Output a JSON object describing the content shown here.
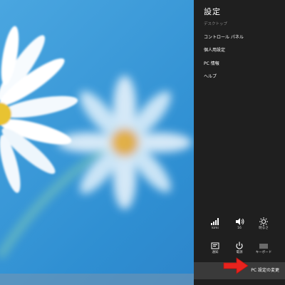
{
  "charm": {
    "title": "設定",
    "context": "デスクトップ",
    "items": [
      {
        "label": "コントロール パネル"
      },
      {
        "label": "個人用設定"
      },
      {
        "label": "PC 情報"
      },
      {
        "label": "ヘルプ"
      }
    ],
    "quick_settings": [
      {
        "icon": "network-icon",
        "label": "kimi"
      },
      {
        "icon": "volume-icon",
        "label": "16"
      },
      {
        "icon": "brightness-icon",
        "label": "明るさ"
      },
      {
        "icon": "notification-icon",
        "label": "通知"
      },
      {
        "icon": "power-icon",
        "label": "電源"
      },
      {
        "icon": "keyboard-icon",
        "label": "キーボード"
      }
    ],
    "change_pc_settings": "PC 設定の変更"
  },
  "colors": {
    "charm_background": "#1f1f1f",
    "change_settings_bar": "#3a3a3a",
    "wallpaper_blue": "#3a9ad8",
    "annotation_arrow": "#e8231e"
  }
}
